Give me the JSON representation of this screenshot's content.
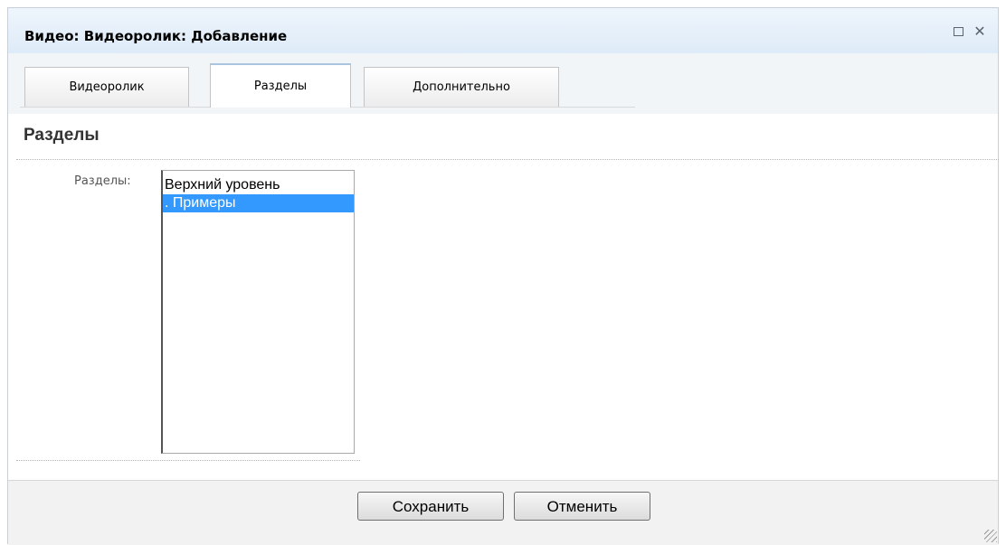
{
  "window": {
    "title": "Видео: Видеоролик: Добавление",
    "maximize_icon": "maximize-icon",
    "close_icon": "close-icon",
    "close_glyph": "✕"
  },
  "tabs": [
    {
      "label": "Видеоролик",
      "active": false
    },
    {
      "label": "Разделы",
      "active": true
    },
    {
      "label": "Дополнительно",
      "active": false
    }
  ],
  "section": {
    "heading": "Разделы",
    "field_label": "Разделы:",
    "options": [
      {
        "label": "Верхний уровень",
        "selected": false
      },
      {
        "label": ". Примеры",
        "selected": true
      }
    ]
  },
  "footer": {
    "save_label": "Сохранить",
    "cancel_label": "Отменить"
  },
  "colors": {
    "selection": "#3399ff",
    "titlebar": "#dbe9f7"
  }
}
